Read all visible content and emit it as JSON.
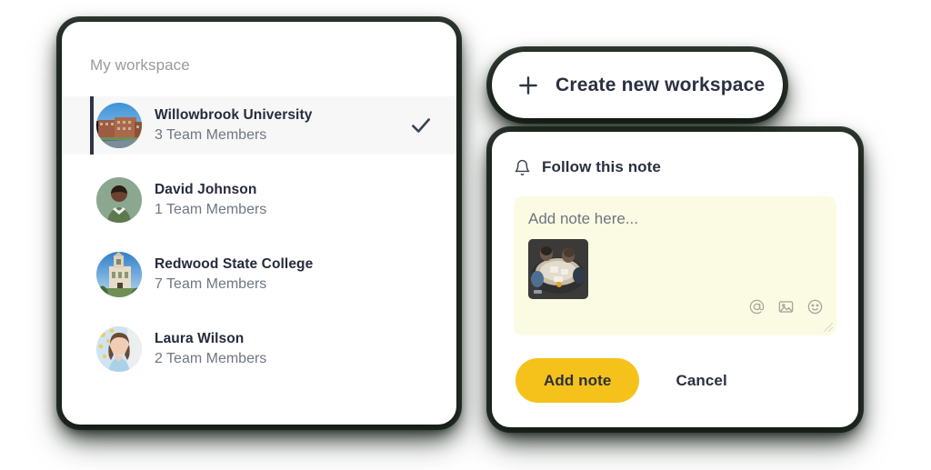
{
  "workspace_panel": {
    "title": "My workspace",
    "items": [
      {
        "name": "Willowbrook University",
        "members": "3 Team Members",
        "selected": true,
        "avatar": "campus-building-photo",
        "check_icon": "check-icon"
      },
      {
        "name": "David Johnson",
        "members": "1 Team Members",
        "selected": false,
        "avatar": "person-portrait-photo"
      },
      {
        "name": "Redwood State College",
        "members": "7 Team Members",
        "selected": false,
        "avatar": "historic-campus-photo"
      },
      {
        "name": "Laura Wilson",
        "members": "2 Team Members",
        "selected": false,
        "avatar": "person-portrait-photo"
      }
    ]
  },
  "create_workspace": {
    "label": "Create new workspace",
    "icon": "plus-icon"
  },
  "note_card": {
    "header_label": "Follow this note",
    "header_icon": "bell-icon",
    "editor": {
      "placeholder": "Add note here...",
      "value": "",
      "attachment": "meeting-table-photo"
    },
    "tools": [
      {
        "icon": "mention-icon",
        "glyph": "@"
      },
      {
        "icon": "image-icon"
      },
      {
        "icon": "emoji-icon"
      }
    ],
    "add_note_label": "Add note",
    "cancel_label": "Cancel"
  },
  "colors": {
    "accent_yellow": "#f5c21b",
    "note_background": "#fbfbe3",
    "selected_row_background": "#f7f7f7",
    "selected_row_bar": "#2f3445",
    "text_primary": "#2b3040",
    "text_secondary": "#707683",
    "title_muted": "#9a9a9a"
  }
}
